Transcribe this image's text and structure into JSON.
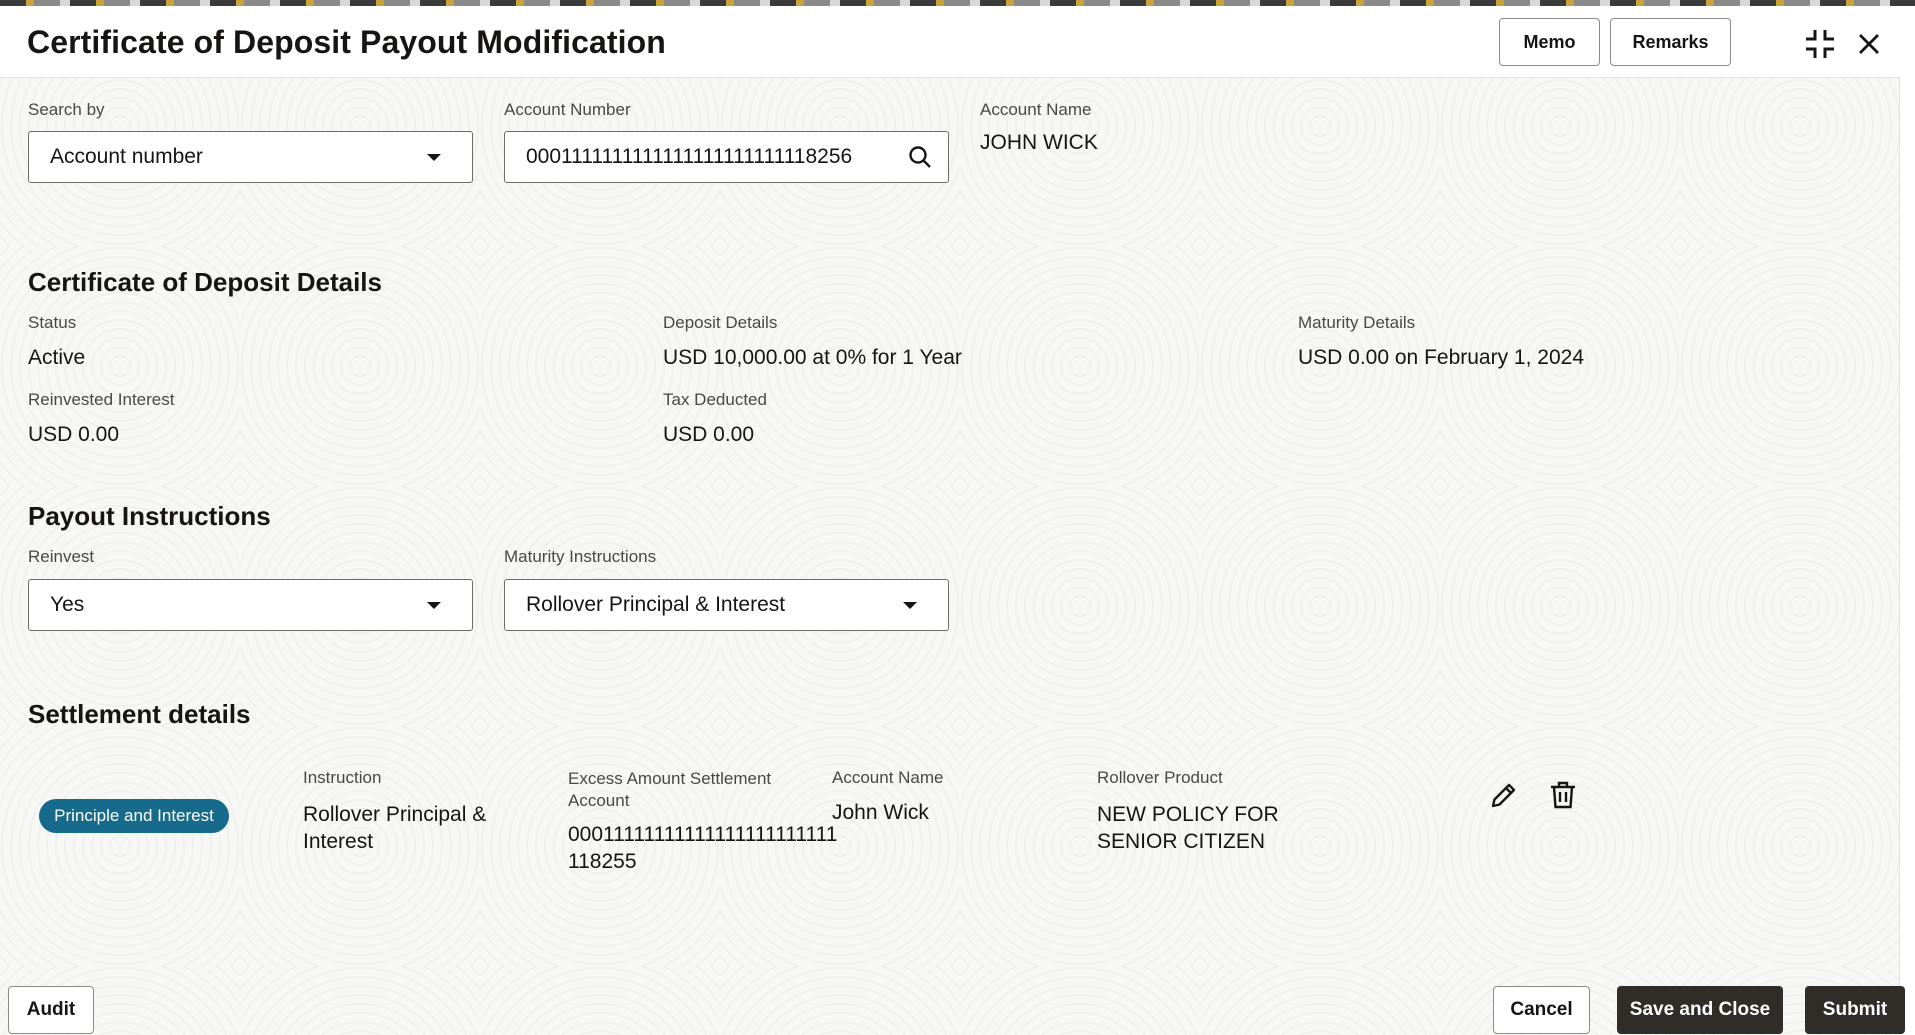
{
  "header": {
    "title": "Certificate of Deposit Payout Modification",
    "memo_label": "Memo",
    "remarks_label": "Remarks",
    "collapse_icon": "collapse-icon",
    "close_icon": "close-icon"
  },
  "search": {
    "search_by_label": "Search by",
    "search_by_value": "Account number",
    "account_number_label": "Account Number",
    "account_number_value": "0001111111111111111111111118256",
    "account_name_label": "Account Name",
    "account_name_value": "JOHN WICK"
  },
  "cd_details": {
    "title": "Certificate of Deposit Details",
    "status_label": "Status",
    "status_value": "Active",
    "deposit_label": "Deposit Details",
    "deposit_value": "USD 10,000.00 at 0% for 1 Year",
    "maturity_label": "Maturity Details",
    "maturity_value": "USD 0.00 on February 1, 2024",
    "reinvested_label": "Reinvested Interest",
    "reinvested_value": "USD 0.00",
    "tax_label": "Tax Deducted",
    "tax_value": "USD 0.00"
  },
  "payout": {
    "title": "Payout Instructions",
    "reinvest_label": "Reinvest",
    "reinvest_value": "Yes",
    "maturity_instr_label": "Maturity Instructions",
    "maturity_instr_value": "Rollover Principal & Interest"
  },
  "settlement": {
    "title": "Settlement details",
    "badge": "Principle and Interest",
    "instruction_label": "Instruction",
    "instruction_line1": "Rollover Principal &",
    "instruction_line2": "Interest",
    "excess_label_line1": "Excess Amount Settlement",
    "excess_label_line2": "Account",
    "excess_value_line1": "00011111111111111111111111",
    "excess_value_line2": "118255",
    "account_name_label": "Account Name",
    "account_name_value": "John Wick",
    "rollover_label": "Rollover Product",
    "rollover_line1": "NEW POLICY FOR",
    "rollover_line2": "SENIOR CITIZEN",
    "edit_icon": "pencil-icon",
    "delete_icon": "trash-icon"
  },
  "footer": {
    "audit_label": "Audit",
    "cancel_label": "Cancel",
    "save_close_label": "Save and Close",
    "submit_label": "Submit"
  }
}
